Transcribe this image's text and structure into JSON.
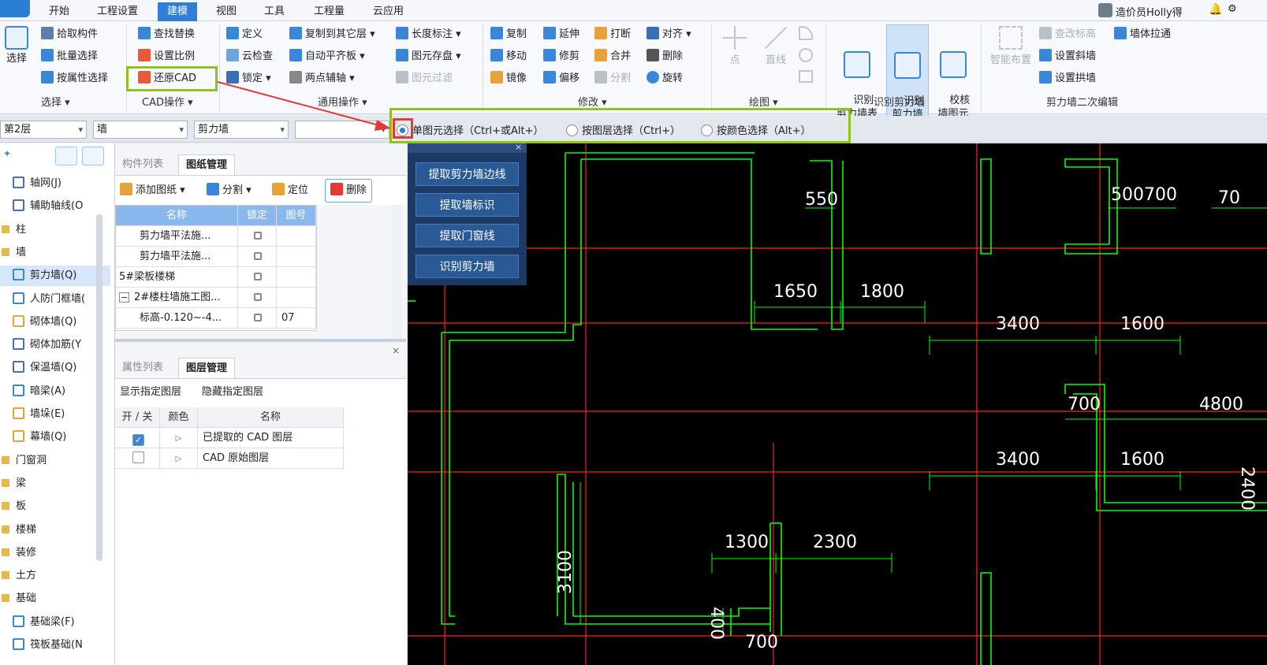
{
  "menubar": {
    "tabs": [
      "开始",
      "工程设置",
      "建模",
      "视图",
      "工具",
      "工程量",
      "云应用"
    ],
    "active_tab": "建模",
    "user": "造价员Holly得"
  },
  "ribbon": {
    "select_big": "选择",
    "select_items": [
      "拾取构件",
      "批量选择",
      "按属性选择"
    ],
    "cad_items": [
      "查找替换",
      "设置比例",
      "还原CAD"
    ],
    "common_items": [
      "定义",
      "云检查",
      "锁定",
      "复制到其它层",
      "自动平齐板",
      "两点辅轴",
      "长度标注",
      "图元存盘",
      "图元过滤"
    ],
    "modify_items": [
      "复制",
      "移动",
      "镜像",
      "延伸",
      "修剪",
      "偏移",
      "打断",
      "合并",
      "分割",
      "对齐",
      "删除",
      "旋转"
    ],
    "draw_items": [
      "点",
      "直线"
    ],
    "recognize_items": [
      "识别\n剪力墙表",
      "识别\n剪力墙",
      "校核\n墙图元"
    ],
    "smart_layout": "智能布置",
    "second_items": [
      "查改标高",
      "设置斜墙",
      "设置拱墙",
      "墙体拉通"
    ],
    "group_labels": [
      "选择",
      "CAD操作",
      "通用操作",
      "修改",
      "绘图",
      "识别剪力墙",
      "剪力墙二次编辑"
    ]
  },
  "toolbar": {
    "floor": "第2层",
    "category": "墙",
    "type": "剪力墙",
    "blank": "",
    "radios": [
      "单图元选择（Ctrl+或Alt+）",
      "按图层选择（Ctrl+）",
      "按颜色选择（Alt+）"
    ],
    "selected_radio": 0
  },
  "nav": {
    "items": [
      {
        "label": "轴网(J)",
        "kind": "item",
        "color": "#4a6fb5"
      },
      {
        "label": "辅助轴线(O",
        "kind": "item",
        "color": "#4a6fb5"
      },
      {
        "label": "柱",
        "kind": "folder"
      },
      {
        "label": "墙",
        "kind": "folder"
      },
      {
        "label": "剪力墙(Q)",
        "kind": "item",
        "color": "#3a86d8",
        "active": true
      },
      {
        "label": "人防门框墙(",
        "kind": "item",
        "color": "#3a86d8"
      },
      {
        "label": "砌体墙(Q)",
        "kind": "item",
        "color": "#e8a23a"
      },
      {
        "label": "砌体加筋(Y",
        "kind": "item",
        "color": "#4a6fb5"
      },
      {
        "label": "保温墙(Q)",
        "kind": "item",
        "color": "#4a6fb5"
      },
      {
        "label": "暗梁(A)",
        "kind": "item",
        "color": "#3a86d8"
      },
      {
        "label": "墙垛(E)",
        "kind": "item",
        "color": "#e8a23a"
      },
      {
        "label": "幕墙(Q)",
        "kind": "item",
        "color": "#e8a23a"
      },
      {
        "label": "门窗洞",
        "kind": "folder"
      },
      {
        "label": "梁",
        "kind": "folder"
      },
      {
        "label": "板",
        "kind": "folder"
      },
      {
        "label": "楼梯",
        "kind": "folder"
      },
      {
        "label": "装修",
        "kind": "folder"
      },
      {
        "label": "土方",
        "kind": "folder"
      },
      {
        "label": "基础",
        "kind": "folder"
      },
      {
        "label": "基础梁(F)",
        "kind": "item",
        "color": "#3a86d8"
      },
      {
        "label": "筏板基础(N",
        "kind": "item",
        "color": "#3a86d8"
      }
    ]
  },
  "drawing_panel": {
    "tabs": [
      "构件列表",
      "图纸管理"
    ],
    "actions": [
      "添加图纸",
      "分割",
      "定位",
      "删除"
    ],
    "columns": [
      "名称",
      "锁定",
      "图号"
    ],
    "rows": [
      {
        "name": "剪力墙平法施...",
        "num": "",
        "indent": 1
      },
      {
        "name": "剪力墙平法施...",
        "num": "",
        "indent": 1
      },
      {
        "name": "5#梁板楼梯",
        "num": "",
        "indent": 0
      },
      {
        "name": "2#楼柱墙施工图...",
        "num": "",
        "indent": 0,
        "toggle": "−"
      },
      {
        "name": "标高-0.120~-4...",
        "num": "07",
        "indent": 1
      }
    ]
  },
  "layer_panel": {
    "tabs": [
      "属性列表",
      "图层管理"
    ],
    "actions": [
      "显示指定图层",
      "隐藏指定图层"
    ],
    "columns": [
      "开 / 关",
      "颜色",
      "名称"
    ],
    "rows": [
      {
        "checked": true,
        "name": "已提取的 CAD 图层"
      },
      {
        "checked": false,
        "name": "CAD 原始图层"
      }
    ]
  },
  "popup": {
    "buttons": [
      "提取剪力墙边线",
      "提取墙标识",
      "提取门窗线",
      "识别剪力墙"
    ]
  },
  "cad": {
    "dims": [
      "550",
      "500700",
      "70",
      "1650",
      "1800",
      "3400",
      "1600",
      "700",
      "4800",
      "2400",
      "3400",
      "1600",
      "1300",
      "2300",
      "3100",
      "400",
      "700"
    ]
  },
  "colors": {
    "accent": "#2f7fd7",
    "highlight": "#8dc21f",
    "arrow": "#e53935",
    "wall": "#00ff00",
    "axis": "#ff2020"
  }
}
